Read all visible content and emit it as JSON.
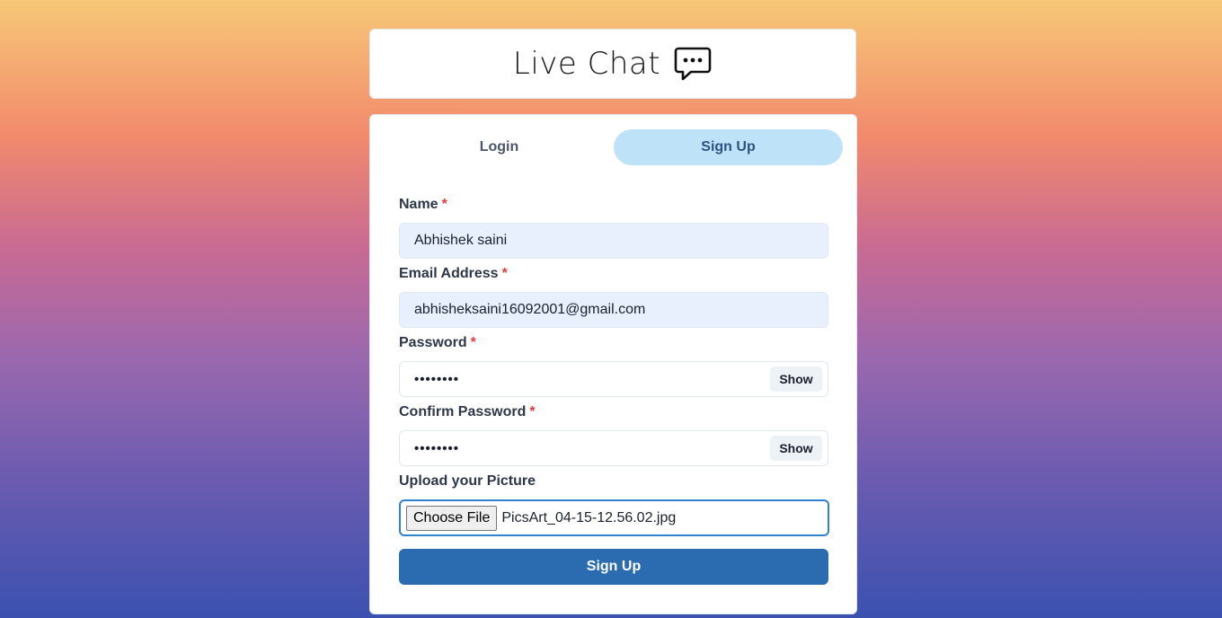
{
  "header": {
    "title": "Live Chat",
    "icon": "chat-dots-icon"
  },
  "tabs": [
    {
      "label": "Login",
      "active": false
    },
    {
      "label": "Sign Up",
      "active": true
    }
  ],
  "form": {
    "name": {
      "label": "Name",
      "required": "*",
      "value": "Abhishek saini"
    },
    "email": {
      "label": "Email Address",
      "required": "*",
      "value": "abhisheksaini16092001@gmail.com"
    },
    "password": {
      "label": "Password",
      "required": "*",
      "value": "••••••••",
      "toggle_label": "Show"
    },
    "confirm_password": {
      "label": "Confirm Password",
      "required": "*",
      "value": "••••••••",
      "toggle_label": "Show"
    },
    "picture": {
      "label": "Upload your Picture",
      "button_label": "Choose File",
      "file_name": "PicsArt_04-15-12.56.02.jpg"
    },
    "submit_label": "Sign Up"
  },
  "colors": {
    "active_tab_bg": "#bee3f8",
    "submit_bg": "#2b6cb0",
    "required_star": "#e53e3e",
    "autofill_bg": "#e8f0fe",
    "focus_border": "#3182ce"
  }
}
